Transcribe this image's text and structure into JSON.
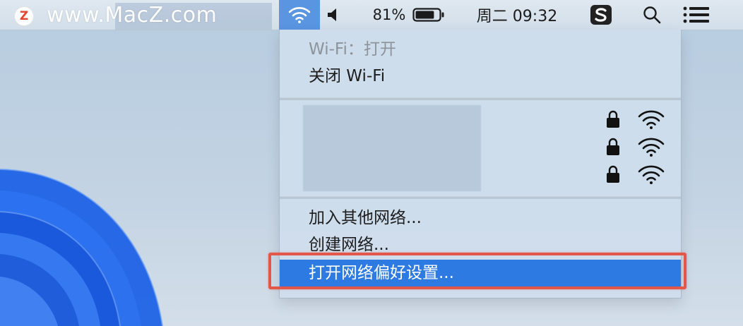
{
  "menubar": {
    "watermark_text": "www.MacZ.com",
    "logo_letter": "Z",
    "battery_percent": "81%",
    "battery_level": 0.81,
    "clock": "周二 09:32",
    "icons": [
      "wifi-icon",
      "speaker-icon",
      "battery-icon",
      "sogou-input-icon",
      "search-icon",
      "control-center-icon"
    ]
  },
  "wifi_menu": {
    "status": "Wi-Fi：打开",
    "toggle_label": "关闭 Wi-Fi",
    "networks": [
      {
        "locked": true,
        "signal": "full"
      },
      {
        "locked": true,
        "signal": "full"
      },
      {
        "locked": true,
        "signal": "full"
      }
    ],
    "join_other": "加入其他网络...",
    "create_network": "创建网络...",
    "open_prefs": "打开网络偏好设置..."
  },
  "colors": {
    "highlight": "#2e7ae3",
    "wifi_active_bg": "#5a95e2",
    "annotation_red": "#e3574b",
    "desktop_wave": "#1f62e6"
  }
}
